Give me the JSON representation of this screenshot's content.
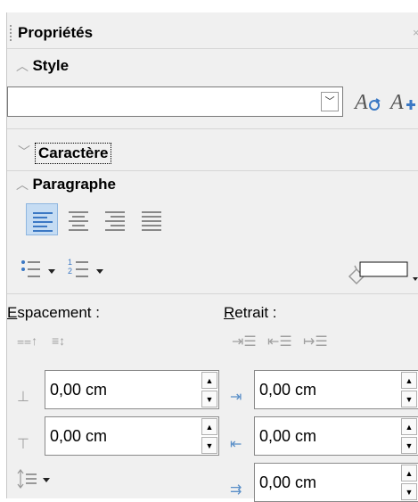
{
  "panel": {
    "title": "Propriétés",
    "close": "×"
  },
  "sections": {
    "style": {
      "chevron": "^",
      "label": "Style"
    },
    "caractere": {
      "chevron": "v",
      "label": "Caractère"
    },
    "paragraphe": {
      "chevron": "^",
      "label": "Paragraphe"
    }
  },
  "style_combo": {
    "value": "",
    "dropdown_glyph": "⌄"
  },
  "alignment": {
    "buttons": [
      "align-left",
      "align-center",
      "align-right",
      "justify"
    ],
    "active": "align-left"
  },
  "spacing": {
    "label_first": "E",
    "label_rest": "spacement :",
    "above_value": "0,00 cm",
    "below_value": "0,00 cm"
  },
  "indent": {
    "label_first": "R",
    "label_rest": "etrait :",
    "before_value": "0,00 cm",
    "after_value": "0,00 cm",
    "first_line_value": "0,00 cm"
  },
  "colors": {
    "accent": "#3b78c4",
    "active_bg": "#c5dcf3",
    "panel_bg": "#f0f0f0"
  }
}
